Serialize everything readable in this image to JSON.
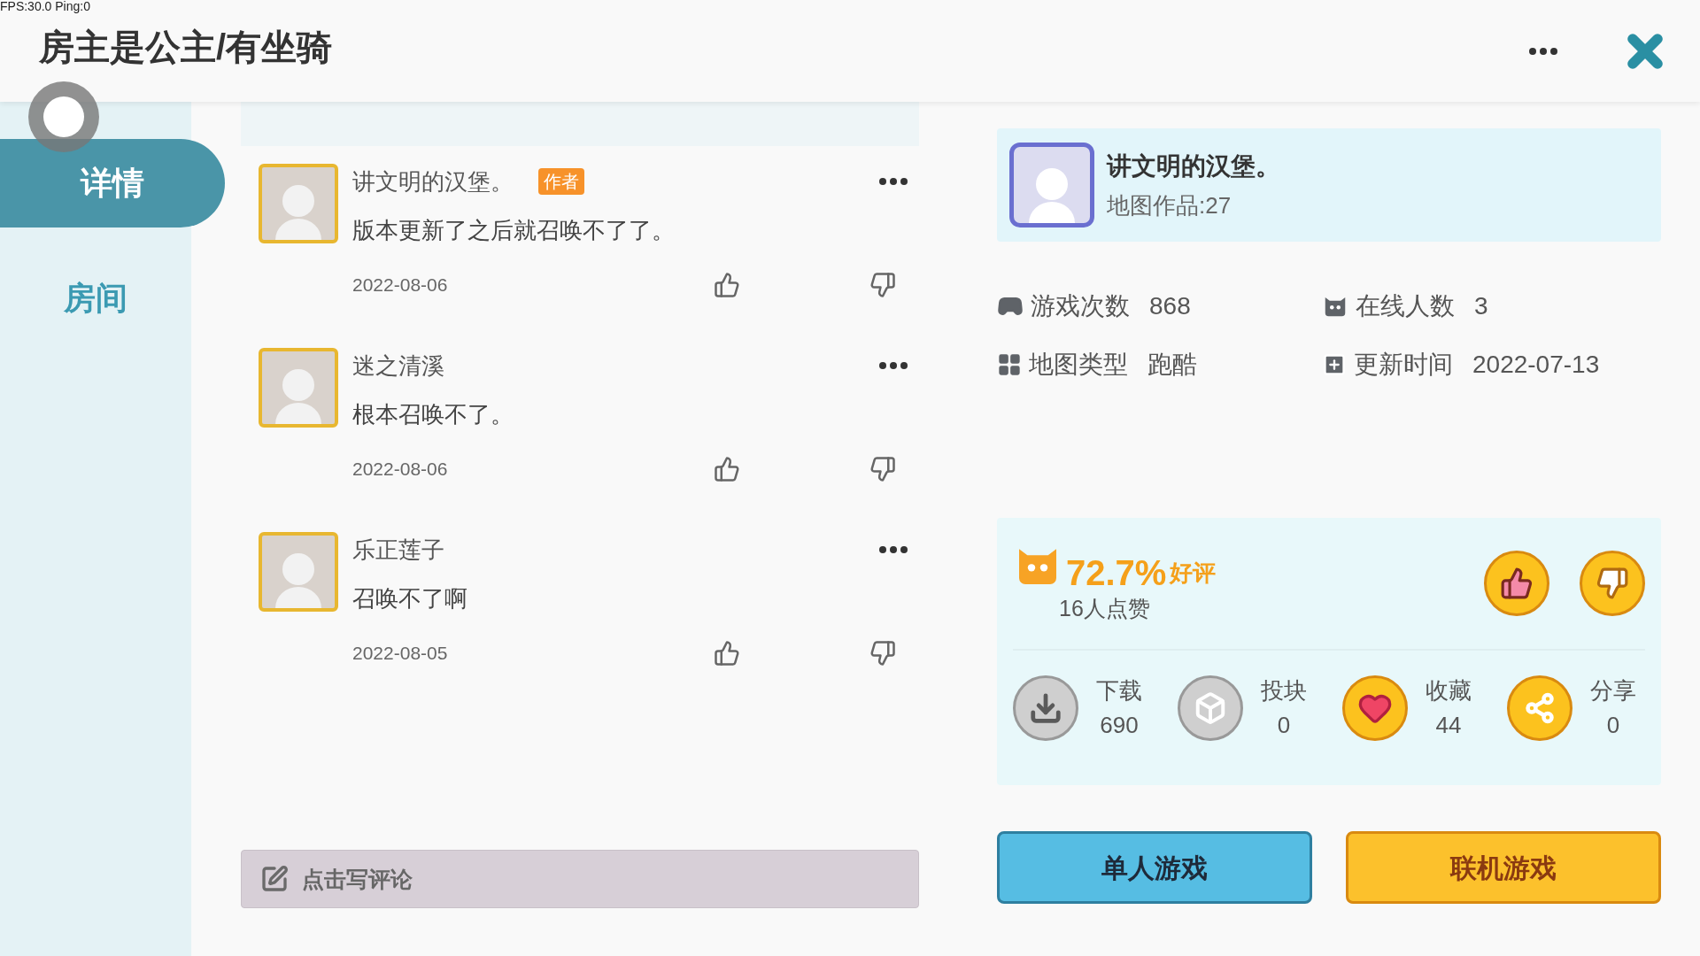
{
  "debug_overlay": "FPS:30.0  Ping:0",
  "header": {
    "title": "房主是公主/有坐骑"
  },
  "tabs": [
    {
      "label": "详情",
      "selected": true
    },
    {
      "label": "房间",
      "selected": false
    }
  ],
  "comments": [
    {
      "author": "讲文明的汉堡。",
      "badge": "作者",
      "text": "版本更新了之后就召唤不了了。",
      "date": "2022-08-06"
    },
    {
      "author": "迷之清溪",
      "text": "根本召唤不了。",
      "date": "2022-08-06"
    },
    {
      "author": "乐正莲子",
      "text": "召唤不了啊",
      "date": "2022-08-05"
    }
  ],
  "comment_input": {
    "placeholder": "点击写评论"
  },
  "author_card": {
    "name": "讲文明的汉堡。",
    "works": "地图作品:27"
  },
  "stats": [
    {
      "kind": "gamepad",
      "label": "游戏次数",
      "value": "868"
    },
    {
      "kind": "online",
      "label": "在线人数",
      "value": "3"
    },
    {
      "kind": "grid",
      "label": "地图类型",
      "value": "跑酷"
    },
    {
      "kind": "update",
      "label": "更新时间",
      "value": "2022-07-13"
    }
  ],
  "rating": {
    "percent": "72.7%",
    "suffix": "好评",
    "likes": "16人点赞"
  },
  "actions": [
    {
      "kind": "download",
      "label": "下载",
      "count": "690",
      "active": false
    },
    {
      "kind": "block",
      "label": "投块",
      "count": "0",
      "active": false
    },
    {
      "kind": "heart",
      "label": "收藏",
      "count": "44",
      "active": true
    },
    {
      "kind": "share",
      "label": "分享",
      "count": "0",
      "active": true
    }
  ],
  "buttons": [
    {
      "kind": "single",
      "label": "单人游戏"
    },
    {
      "kind": "multi",
      "label": "联机游戏"
    }
  ]
}
